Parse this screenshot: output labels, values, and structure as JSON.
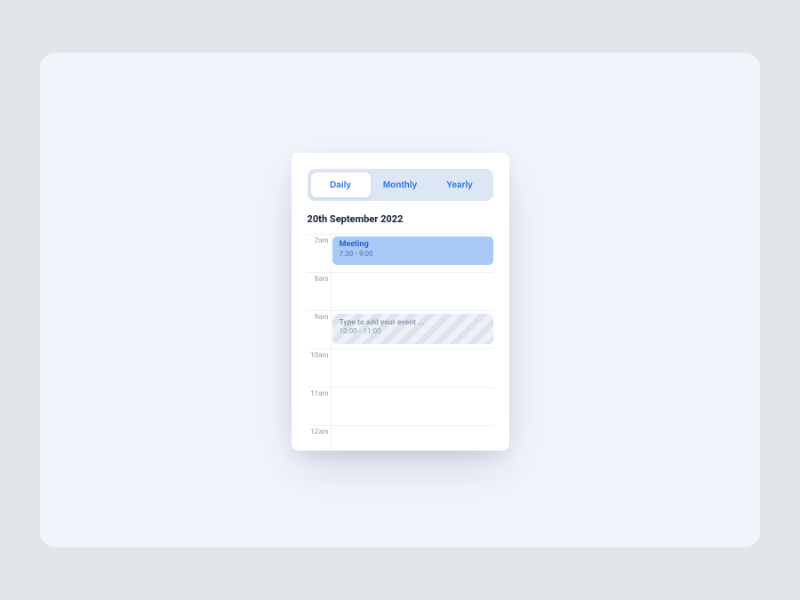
{
  "tabs": {
    "daily": "Daily",
    "monthly": "Monthly",
    "yearly": "Yearly",
    "active": "daily"
  },
  "date": "20th September 2022",
  "hours": [
    "7am",
    "8am",
    "9am",
    "10am",
    "11am",
    "12am"
  ],
  "events": {
    "meeting": {
      "title": "Meeting",
      "time": "7:30 - 9:00"
    },
    "draft": {
      "placeholder": "Type to add your event ...",
      "time": "10:00 - 11:00"
    }
  }
}
